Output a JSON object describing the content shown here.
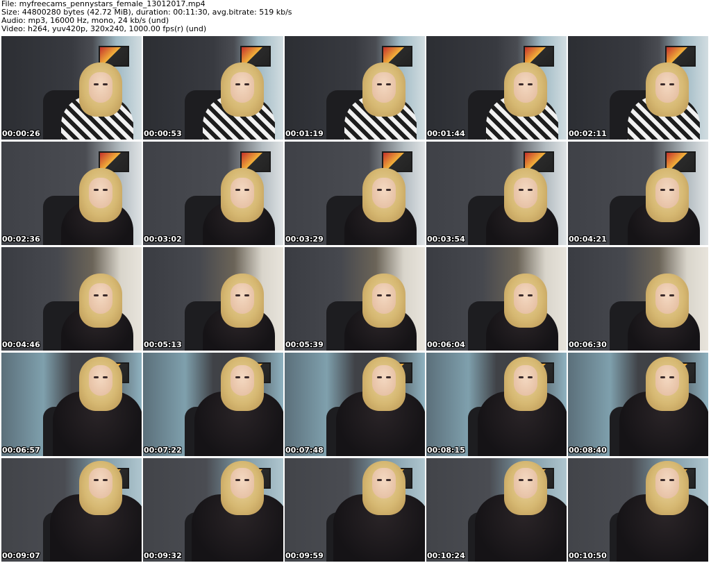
{
  "header": {
    "file_line": "File: myfreecams_pennystars_female_13012017.mp4",
    "size_line": "Size: 44800280 bytes (42.72 MiB), duration: 00:11:30, avg.bitrate: 519 kb/s",
    "audio_line": "Audio: mp3, 16000 Hz, mono, 24 kb/s (und)",
    "video_line": "Video: h264, yuv420p, 320x240, 1000.00 fps(r) (und)"
  },
  "thumbnails": [
    {
      "timestamp": "00:00:26"
    },
    {
      "timestamp": "00:00:53"
    },
    {
      "timestamp": "00:01:19"
    },
    {
      "timestamp": "00:01:44"
    },
    {
      "timestamp": "00:02:11"
    },
    {
      "timestamp": "00:02:36"
    },
    {
      "timestamp": "00:03:02"
    },
    {
      "timestamp": "00:03:29"
    },
    {
      "timestamp": "00:03:54"
    },
    {
      "timestamp": "00:04:21"
    },
    {
      "timestamp": "00:04:46"
    },
    {
      "timestamp": "00:05:13"
    },
    {
      "timestamp": "00:05:39"
    },
    {
      "timestamp": "00:06:04"
    },
    {
      "timestamp": "00:06:30"
    },
    {
      "timestamp": "00:06:57"
    },
    {
      "timestamp": "00:07:22"
    },
    {
      "timestamp": "00:07:48"
    },
    {
      "timestamp": "00:08:15"
    },
    {
      "timestamp": "00:08:40"
    },
    {
      "timestamp": "00:09:07"
    },
    {
      "timestamp": "00:09:32"
    },
    {
      "timestamp": "00:09:59"
    },
    {
      "timestamp": "00:10:24"
    },
    {
      "timestamp": "00:10:50"
    }
  ]
}
